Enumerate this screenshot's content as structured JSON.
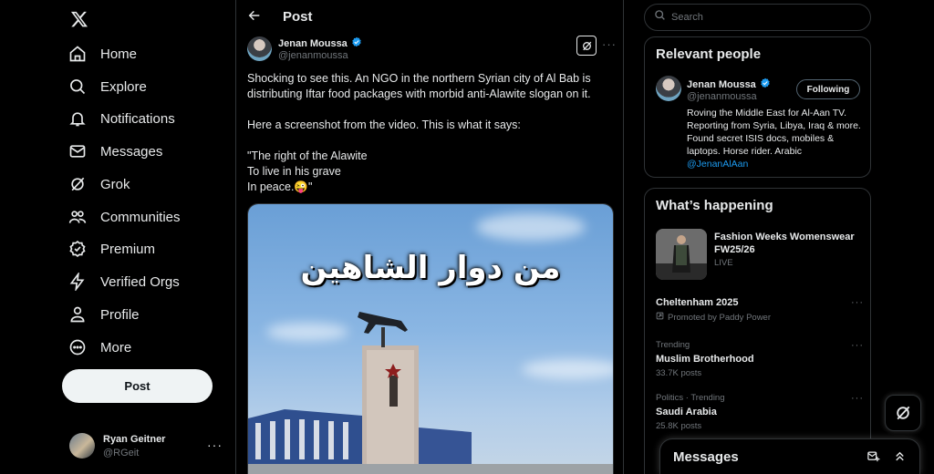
{
  "nav": {
    "items": [
      {
        "label": "Home",
        "icon": "home-icon"
      },
      {
        "label": "Explore",
        "icon": "search-icon"
      },
      {
        "label": "Notifications",
        "icon": "bell-icon"
      },
      {
        "label": "Messages",
        "icon": "envelope-icon"
      },
      {
        "label": "Grok",
        "icon": "grok-icon"
      },
      {
        "label": "Communities",
        "icon": "people-icon"
      },
      {
        "label": "Premium",
        "icon": "premium-icon"
      },
      {
        "label": "Verified Orgs",
        "icon": "lightning-icon"
      },
      {
        "label": "Profile",
        "icon": "person-icon"
      },
      {
        "label": "More",
        "icon": "more-circle-icon"
      }
    ],
    "post_label": "Post"
  },
  "account": {
    "name": "Ryan Geitner",
    "handle": "@RGeit"
  },
  "header": {
    "title": "Post"
  },
  "post": {
    "author_name": "Jenan Moussa",
    "author_handle": "@jenanmoussa",
    "text": "Shocking to see this. An NGO in the northern Syrian city of Al Bab is distributing Iftar food packages with morbid anti-Alawite slogan on it.\n\nHere a screenshot from the video. This is what it says:\n\n\"The right of the Alawite\nTo live in his grave\nIn peace.😜\"",
    "image_overlay_text": "من دوار الشاهين"
  },
  "search": {
    "placeholder": "Search"
  },
  "relevant_people": {
    "title": "Relevant people",
    "name": "Jenan Moussa",
    "handle": "@jenanmoussa",
    "follow_label": "Following",
    "bio": "Roving the Middle East for Al-Aan TV. Reporting from Syria, Libya, Iraq & more. Found secret ISIS docs, mobiles & laptops. Horse rider. Arabic",
    "bio_link": "@JenanAlAan"
  },
  "whats_happening": {
    "title": "What’s happening",
    "event": {
      "title": "Fashion Weeks Womenswear FW25/26",
      "status": "LIVE"
    },
    "trends": [
      {
        "meta": "",
        "topic": "Cheltenham 2025",
        "sub": "Promoted by Paddy Power"
      },
      {
        "meta": "Trending",
        "topic": "Muslim Brotherhood",
        "sub": "33.7K posts"
      },
      {
        "meta": "Politics · Trending",
        "topic": "Saudi Arabia",
        "sub": "25.8K posts"
      }
    ]
  },
  "messages_drawer": {
    "title": "Messages"
  },
  "colors": {
    "accent": "#1d9bf0",
    "background": "#000000",
    "border": "#2f3336",
    "muted": "#71767b"
  }
}
